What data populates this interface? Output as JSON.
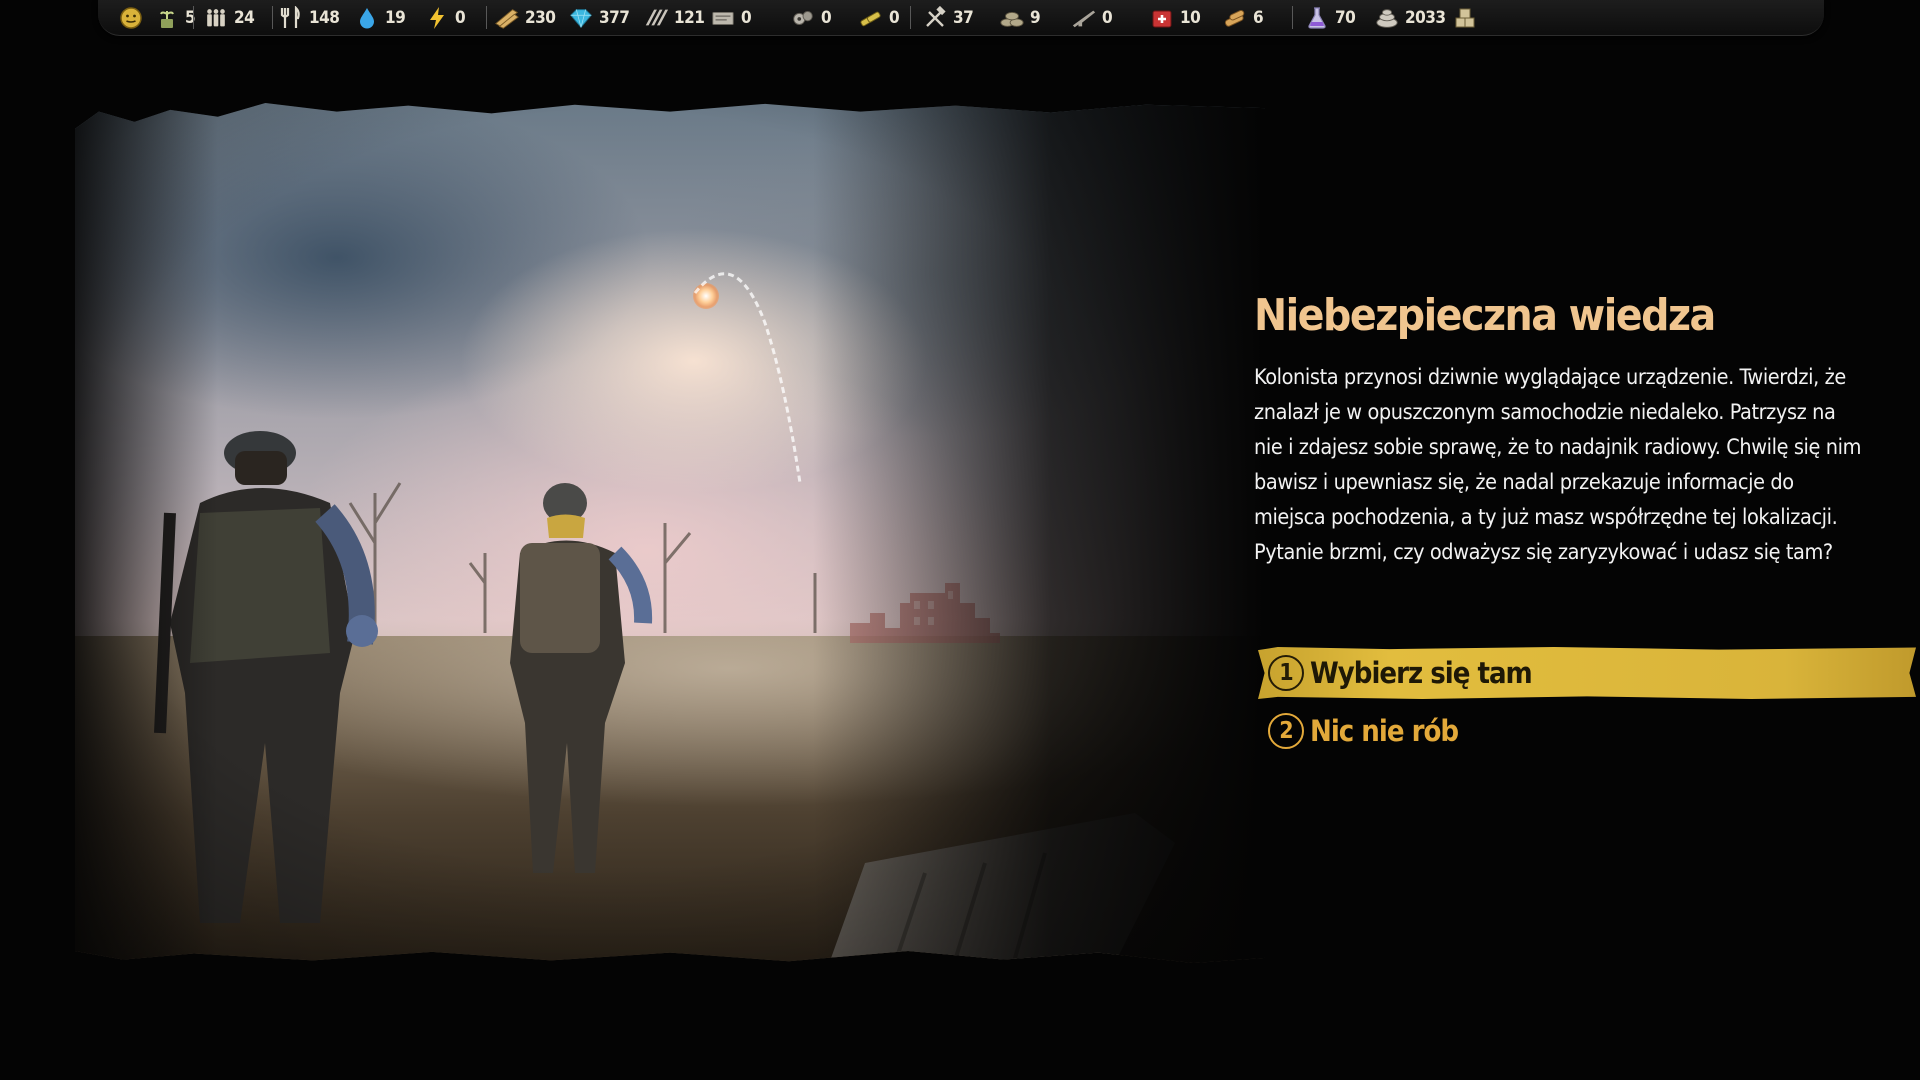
{
  "resources": [
    {
      "icon": "smiley-face-icon",
      "value": ""
    },
    {
      "icon": "colonist-plant-icon",
      "value": "5"
    },
    {
      "icon": "population-icon",
      "value": "24"
    },
    {
      "icon": "food-fork-knife-icon",
      "value": "148"
    },
    {
      "icon": "water-drop-icon",
      "value": "19"
    },
    {
      "icon": "energy-bolt-icon",
      "value": "0"
    },
    {
      "icon": "wood-planks-icon",
      "value": "230"
    },
    {
      "icon": "blue-crystal-icon",
      "value": "377"
    },
    {
      "icon": "metal-bars-icon",
      "value": "121"
    },
    {
      "icon": "document-box-icon",
      "value": "0"
    },
    {
      "icon": "gears-parts-icon",
      "value": "0"
    },
    {
      "icon": "fuel-cells-icon",
      "value": "0"
    },
    {
      "icon": "tools-icon",
      "value": "37"
    },
    {
      "icon": "sandbags-icon",
      "value": "9"
    },
    {
      "icon": "rifle-icon",
      "value": "0"
    },
    {
      "icon": "medkit-icon",
      "value": "10"
    },
    {
      "icon": "bread-ration-icon",
      "value": "6"
    },
    {
      "icon": "chemistry-flask-icon",
      "value": "70"
    },
    {
      "icon": "scrap-pile-icon",
      "value": "2033"
    },
    {
      "icon": "storage-crates-icon",
      "value": ""
    }
  ],
  "event": {
    "title": "Niebezpieczna wiedza",
    "description": "Kolonista przynosi dziwnie wyglądające urządzenie. Twierdzi, że znalazł je w opuszczonym samochodzie niedaleko. Patrzysz na nie i zdajesz sobie sprawę, że to nadajnik radiowy. Chwilę się nim bawisz i upewniasz się, że nadal przekazuje informacje do miejsca pochodzenia, a ty już masz współrzędne tej lokalizacji. Pytanie brzmi, czy odważysz się zaryzykować i udasz się tam?",
    "choices": [
      {
        "number": "1",
        "label": "Wybierz się tam",
        "selected": true
      },
      {
        "number": "2",
        "label": "Nic nie rób",
        "selected": false
      }
    ]
  },
  "colors": {
    "title": "#f0c58f",
    "choice_selected_bg": "#d9b43a",
    "choice_text": "#e3a93a"
  }
}
